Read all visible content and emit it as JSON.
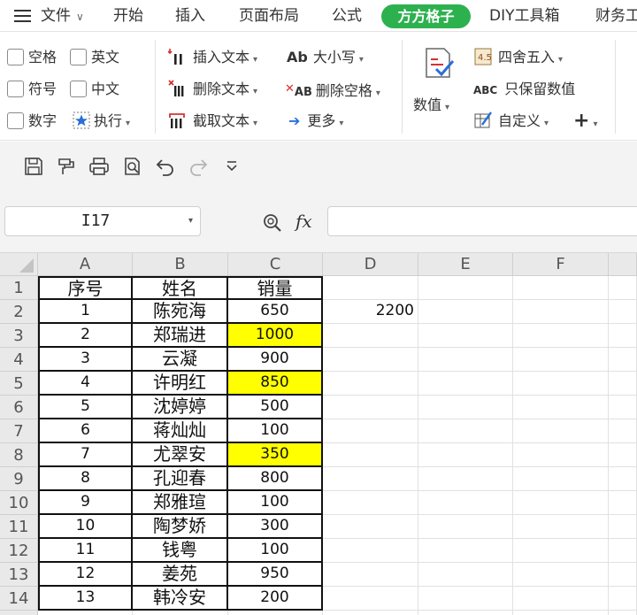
{
  "menubar": {
    "items": [
      "文件",
      "开始",
      "插入",
      "页面布局",
      "公式",
      "方方格子",
      "DIY工具箱",
      "财务工"
    ]
  },
  "ribbon": {
    "checkboxes": [
      "空格",
      "英文",
      "符号",
      "中文",
      "数字"
    ],
    "execute": "执行",
    "insert_text": "插入文本",
    "delete_text": "删除文本",
    "extract_text": "截取文本",
    "case": "大小写",
    "delete_space": "删除空格",
    "more": "更多",
    "number": "数值",
    "round": "四舍五入",
    "keep_numbers": "只保留数值",
    "custom": "自定义",
    "case_icon": "Ab",
    "delspace_icon": "AB",
    "keepnum_icon": "ABC"
  },
  "formula_bar": {
    "cell_ref": "I17",
    "fx": "fx",
    "formula": ""
  },
  "grid": {
    "columns": [
      "A",
      "B",
      "C",
      "D",
      "E",
      "F"
    ],
    "rows": [
      [
        "序号",
        "姓名",
        "销量",
        "",
        "",
        ""
      ],
      [
        "1",
        "陈宛海",
        "650",
        "2200",
        "",
        ""
      ],
      [
        "2",
        "郑瑞进",
        "1000",
        "",
        "",
        ""
      ],
      [
        "3",
        "云凝",
        "900",
        "",
        "",
        ""
      ],
      [
        "4",
        "许明红",
        "850",
        "",
        "",
        ""
      ],
      [
        "5",
        "沈婷婷",
        "500",
        "",
        "",
        ""
      ],
      [
        "6",
        "蒋灿灿",
        "100",
        "",
        "",
        ""
      ],
      [
        "7",
        "尤翠安",
        "350",
        "",
        "",
        ""
      ],
      [
        "8",
        "孔迎春",
        "800",
        "",
        "",
        ""
      ],
      [
        "9",
        "郑雅瑄",
        "100",
        "",
        "",
        ""
      ],
      [
        "10",
        "陶梦娇",
        "300",
        "",
        "",
        ""
      ],
      [
        "11",
        "钱粤",
        "100",
        "",
        "",
        ""
      ],
      [
        "12",
        "姜苑",
        "950",
        "",
        "",
        ""
      ],
      [
        "13",
        "韩冷安",
        "200",
        "",
        "",
        ""
      ]
    ],
    "highlighted_rows": [
      3,
      5,
      8
    ],
    "highlight_color": "#ffff00",
    "accent_color": "#2db14f"
  }
}
